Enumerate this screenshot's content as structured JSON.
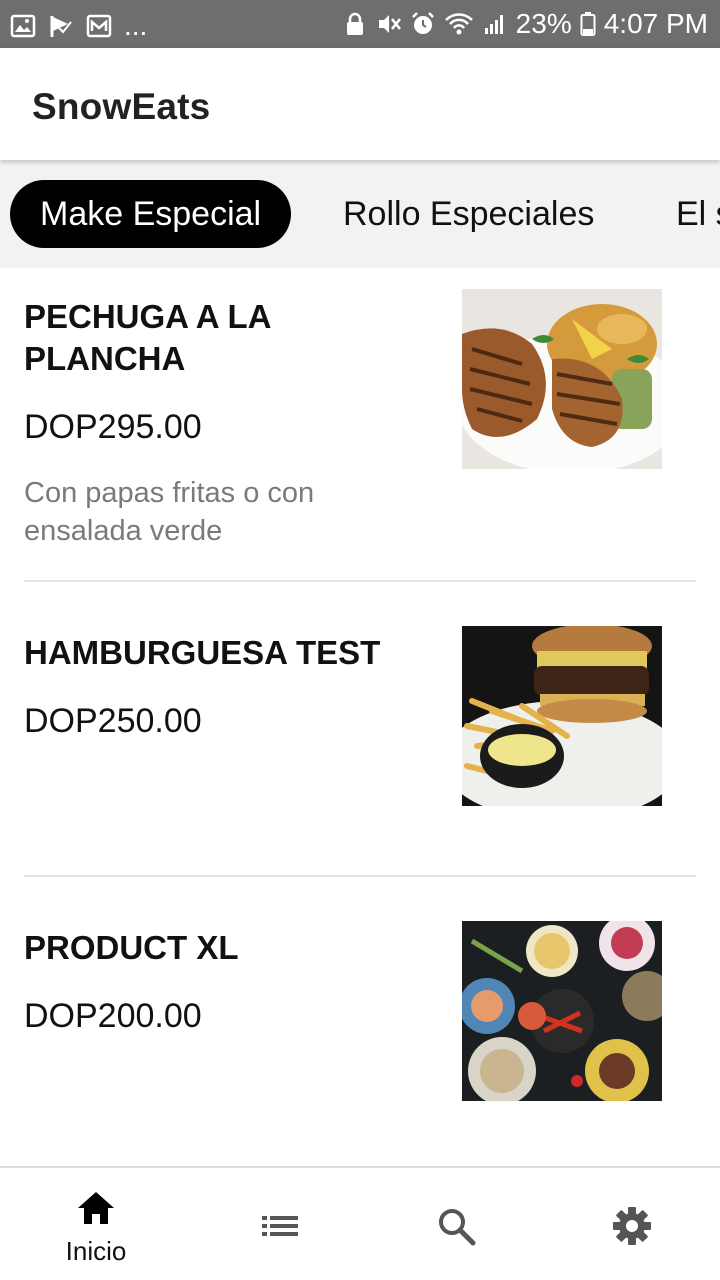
{
  "status_bar": {
    "left_icons": [
      "gallery-icon",
      "check-flag-icon",
      "mail-icon"
    ],
    "overflow": "...",
    "battery": "23%",
    "time": "4:07 PM"
  },
  "app": {
    "title": "SnowEats"
  },
  "tabs": [
    {
      "label": "Make Especial",
      "active": true
    },
    {
      "label": "Rollo Especiales",
      "active": false
    },
    {
      "label": "El s",
      "active": false
    }
  ],
  "items": [
    {
      "name": "PECHUGA A LA PLANCHA",
      "price": "DOP295.00",
      "description": "Con papas fritas o con ensalada verde",
      "photo": "grilled-chicken-photo"
    },
    {
      "name": "HAMBURGUESA TEST",
      "price": "DOP250.00",
      "description": "",
      "photo": "burger-fries-photo"
    },
    {
      "name": "PRODUCT XL",
      "price": "DOP200.00",
      "description": "",
      "photo": "food-spread-photo"
    }
  ],
  "bottom_nav": [
    {
      "icon": "home-icon",
      "label": "Inicio",
      "active": true
    },
    {
      "icon": "list-icon",
      "label": ""
    },
    {
      "icon": "search-icon",
      "label": ""
    },
    {
      "icon": "settings-icon",
      "label": ""
    }
  ],
  "colors": {
    "status_bar": "#6e6e6e",
    "tabs_background": "#f2f2f2",
    "active_tab": "#000000",
    "description_text": "#7a7a7a",
    "nav_icon_inactive": "#555555"
  }
}
